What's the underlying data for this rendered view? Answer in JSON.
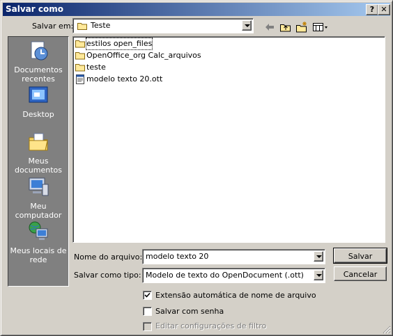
{
  "title": "Salvar como",
  "title_buttons": {
    "help": "?",
    "close": "✕"
  },
  "save_in": {
    "label": "Salvar em:",
    "value": "Teste"
  },
  "toolbar": {
    "back_icon": "back-arrow-icon",
    "up_icon": "up-folder-icon",
    "new_folder_icon": "new-folder-icon",
    "views_icon": "views-menu-icon"
  },
  "places": [
    {
      "label": "Documentos recentes",
      "icon": "recent-documents-icon"
    },
    {
      "label": "Desktop",
      "icon": "desktop-icon"
    },
    {
      "label": "Meus documentos",
      "icon": "my-documents-icon"
    },
    {
      "label": "Meu computador",
      "icon": "my-computer-icon"
    },
    {
      "label": "Meus locais de rede",
      "icon": "network-places-icon"
    }
  ],
  "files": [
    {
      "name": "estilos open_files",
      "type": "folder"
    },
    {
      "name": "OpenOffice_org Calc_arquivos",
      "type": "folder"
    },
    {
      "name": "teste",
      "type": "folder"
    },
    {
      "name": "modelo texto 20.ott",
      "type": "template"
    }
  ],
  "filename": {
    "label": "Nome do arquivo:",
    "value": "modelo texto 20"
  },
  "filetype": {
    "label": "Salvar como tipo:",
    "value": "Modelo de texto do OpenDocument (.ott)"
  },
  "buttons": {
    "save": "Salvar",
    "cancel": "Cancelar"
  },
  "options": [
    {
      "label": "Extensão automática de nome de arquivo",
      "checked": true,
      "enabled": true
    },
    {
      "label": "Salvar com senha",
      "checked": false,
      "enabled": true
    },
    {
      "label": "Editar configurações de filtro",
      "checked": false,
      "enabled": false
    }
  ]
}
